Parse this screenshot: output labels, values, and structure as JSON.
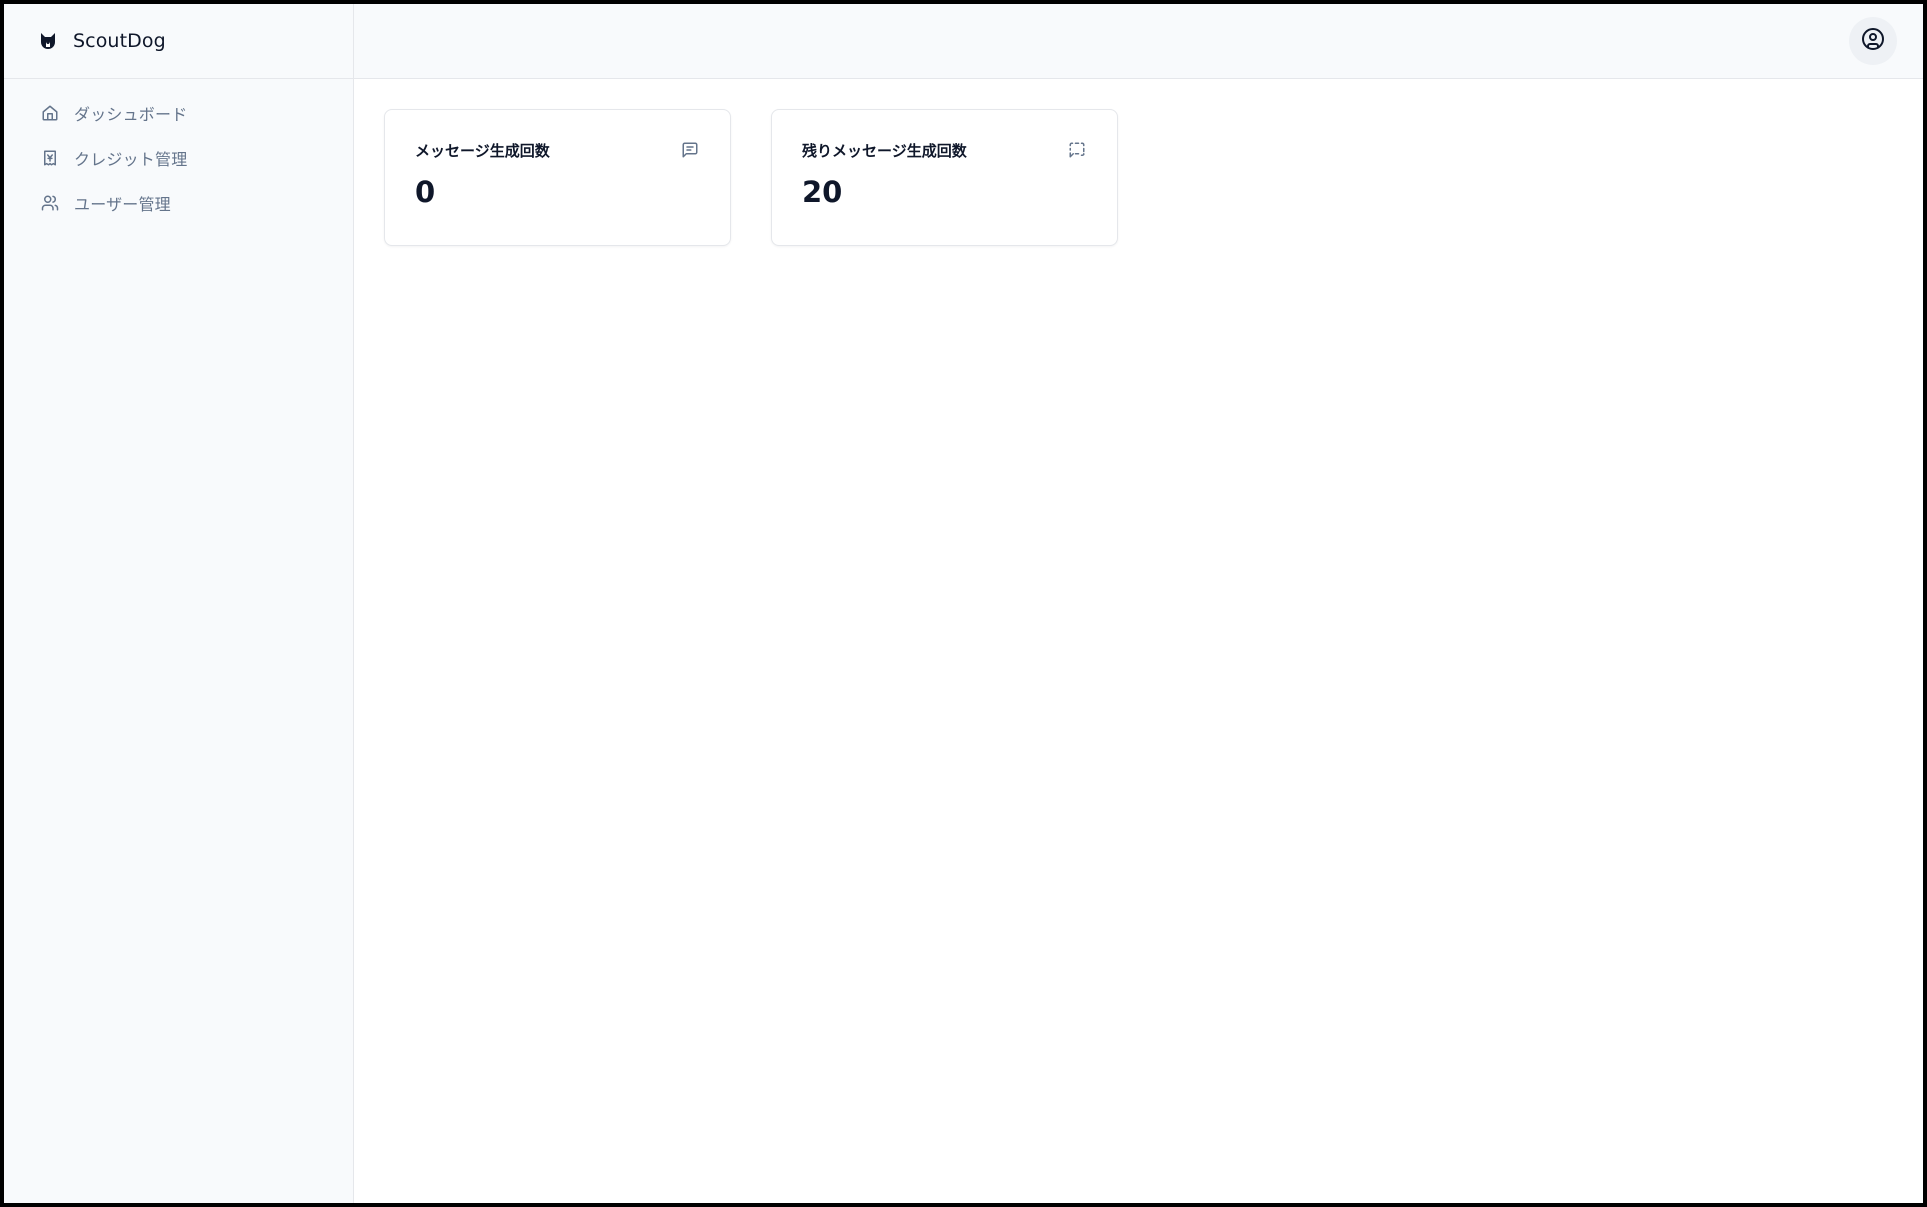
{
  "app": {
    "name": "ScoutDog",
    "logo_icon": "dog-face-icon"
  },
  "sidebar": {
    "items": [
      {
        "label": "ダッシュボード",
        "icon": "home-icon"
      },
      {
        "label": "クレジット管理",
        "icon": "yen-receipt-icon"
      },
      {
        "label": "ユーザー管理",
        "icon": "users-icon"
      }
    ]
  },
  "topbar": {
    "user_icon": "user-circle-icon"
  },
  "stats": [
    {
      "title": "メッセージ生成回数",
      "value": "0",
      "icon": "message-square-text-icon"
    },
    {
      "title": "残りメッセージ生成回数",
      "value": "20",
      "icon": "message-square-dashed-icon"
    }
  ],
  "colors": {
    "sidebar_bg": "#f8fafc",
    "border": "#e5e7eb",
    "nav_text": "#64748b",
    "text_primary": "#0f172a"
  }
}
